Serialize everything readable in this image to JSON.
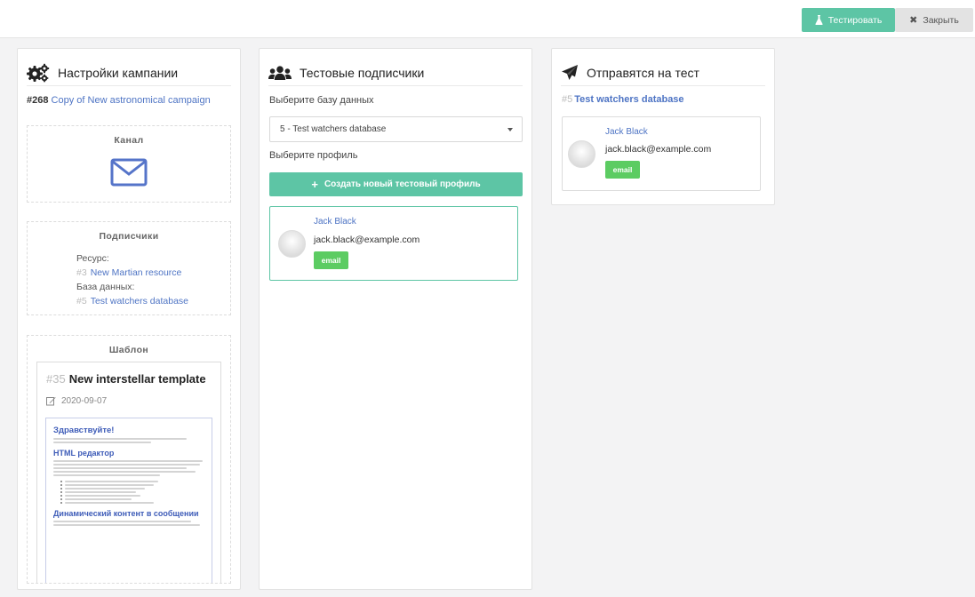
{
  "toolbar": {
    "test_label": "Тестировать",
    "close_label": "Закрыть"
  },
  "settings_panel": {
    "title": "Настройки кампании",
    "campaign_number": "#268",
    "campaign_name": "Copy of New astronomical campaign",
    "channel": {
      "title": "Канал",
      "icon": "envelope-icon"
    },
    "subscribers": {
      "title": "Подписчики",
      "resource_label": "Ресурс:",
      "resource_number": "#3",
      "resource_name": "New Martian resource",
      "database_label": "База данных:",
      "database_number": "#5",
      "database_name": "Test watchers database"
    },
    "template": {
      "title": "Шаблон",
      "number": "#35",
      "name": "New interstellar template",
      "date": "2020-09-07",
      "preview": {
        "greeting": "Здравствуйте!",
        "heading_editor": "HTML редактор",
        "heading_dynamic": "Динамический контент в сообщении"
      }
    }
  },
  "test_subscribers_panel": {
    "title": "Тестовые подписчики",
    "database_label": "Выберите базу данных",
    "database_selected": "5 - Test watchers database",
    "profile_label": "Выберите профиль",
    "create_button": "Создать новый тестовый профиль",
    "profile": {
      "name": "Jack Black",
      "email": "jack.black@example.com",
      "channel_badge": "email"
    }
  },
  "send_panel": {
    "title": "Отправятся на тест",
    "database_number": "#5",
    "database_name": "Test watchers database",
    "profile": {
      "name": "Jack Black",
      "email": "jack.black@example.com",
      "channel_badge": "email"
    }
  },
  "colors": {
    "accent": "#5dc5a5",
    "link": "#4e74c4",
    "badge": "#5ccc62"
  }
}
